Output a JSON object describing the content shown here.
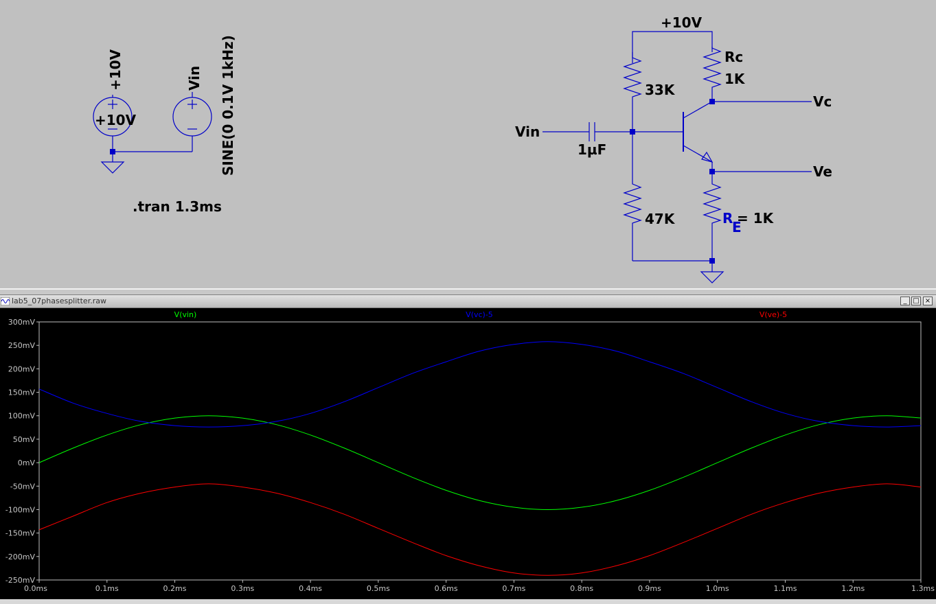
{
  "schematic": {
    "source1": {
      "net_label": "+10V",
      "value": "+10V"
    },
    "source2": {
      "net_label": "Vin",
      "value": "SINE(0 0.1V 1kHz)"
    },
    "directive": ".tran 1.3ms",
    "supply_label": "+10V",
    "vin_label": "Vin",
    "capacitor": "1µF",
    "r_top": "33K",
    "r_bottom": "47K",
    "rc_name": "Rc",
    "rc_value": "1K",
    "re_name": "R",
    "re_sub": "E",
    "re_value": "= 1K",
    "vc_label": "Vc",
    "ve_label": "Ve"
  },
  "waveform_window": {
    "title": "lab5_07phasesplitter.raw",
    "buttons": {
      "minimize": "_",
      "maximize": "□",
      "close": "×"
    }
  },
  "chart_data": {
    "type": "line",
    "xlim": [
      0,
      1.3
    ],
    "ylim": [
      -250,
      300
    ],
    "x_unit": "ms",
    "y_unit": "mV",
    "x_ticks": [
      0,
      0.1,
      0.2,
      0.3,
      0.4,
      0.5,
      0.6,
      0.7,
      0.8,
      0.9,
      1.0,
      1.1,
      1.2,
      1.3
    ],
    "x_tick_labels": [
      "0.0ms",
      "0.1ms",
      "0.2ms",
      "0.3ms",
      "0.4ms",
      "0.5ms",
      "0.6ms",
      "0.7ms",
      "0.8ms",
      "0.9ms",
      "1.0ms",
      "1.1ms",
      "1.2ms",
      "1.3ms"
    ],
    "y_ticks": [
      300,
      250,
      200,
      150,
      100,
      50,
      0,
      -50,
      -100,
      -150,
      -200,
      -250
    ],
    "y_tick_labels": [
      "300mV",
      "250mV",
      "200mV",
      "150mV",
      "100mV",
      "50mV",
      "0mV",
      "-50mV",
      "-100mV",
      "-150mV",
      "-200mV",
      "-250mV"
    ],
    "grid": false,
    "legend": "top",
    "x": [
      0,
      0.05,
      0.1,
      0.15,
      0.2,
      0.25,
      0.3,
      0.35,
      0.4,
      0.45,
      0.5,
      0.55,
      0.6,
      0.65,
      0.7,
      0.75,
      0.8,
      0.85,
      0.9,
      0.95,
      1.0,
      1.05,
      1.1,
      1.15,
      1.2,
      1.25,
      1.3
    ],
    "series": [
      {
        "name": "V(vin)",
        "color": "#00ff00",
        "values": [
          0,
          31,
          59,
          81,
          95,
          100,
          95,
          81,
          59,
          31,
          0,
          -31,
          -59,
          -81,
          -95,
          -100,
          -95,
          -81,
          -59,
          -31,
          0,
          31,
          59,
          81,
          95,
          100,
          95
        ]
      },
      {
        "name": "V(vc)-5",
        "color": "#0000ff",
        "values": [
          157,
          127,
          105,
          88,
          79,
          76,
          79,
          88,
          105,
          130,
          160,
          190,
          215,
          238,
          252,
          258,
          252,
          238,
          215,
          190,
          160,
          130,
          105,
          88,
          79,
          76,
          79
        ]
      },
      {
        "name": "V(ve)-5",
        "color": "#ff0000",
        "values": [
          -143,
          -114,
          -85,
          -65,
          -52,
          -45,
          -52,
          -65,
          -85,
          -110,
          -140,
          -170,
          -198,
          -220,
          -235,
          -240,
          -235,
          -220,
          -198,
          -170,
          -140,
          -110,
          -85,
          -65,
          -52,
          -45,
          -52
        ]
      }
    ]
  }
}
